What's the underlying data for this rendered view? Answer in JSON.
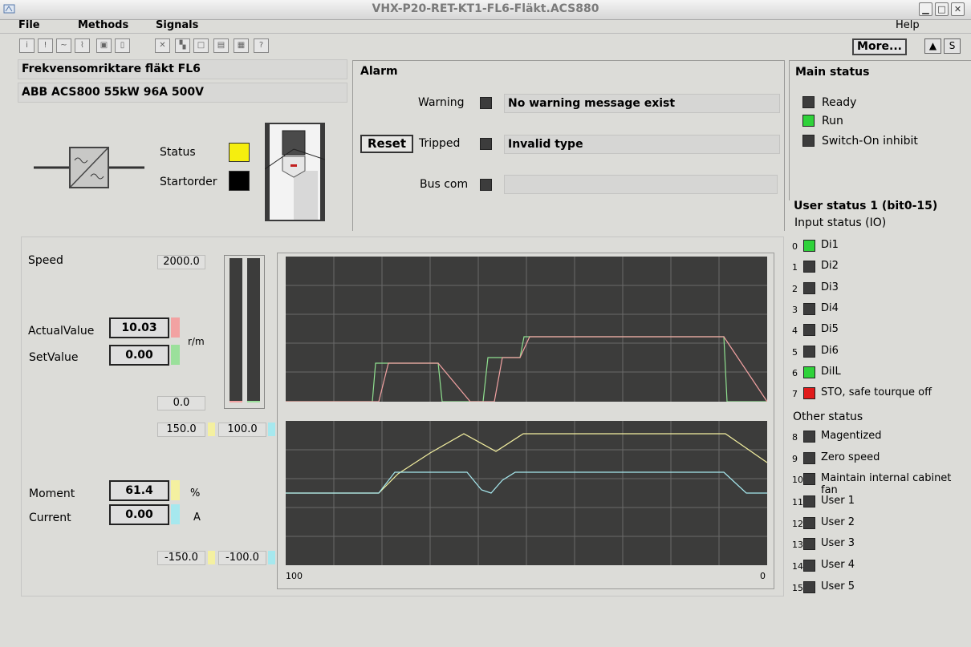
{
  "window": {
    "title": "VHX-P20-RET-KT1-FL6-Fläkt.ACS880"
  },
  "menu": {
    "file": "File",
    "methods": "Methods",
    "signals": "Signals",
    "help": "Help"
  },
  "toolbar": {
    "more_label": "More..."
  },
  "device": {
    "name": "Frekvensomriktare fläkt FL6",
    "model": "ABB ACS800 55kW 96A 500V"
  },
  "indicators": {
    "status_label": "Status",
    "status_color": "#f5ee0f",
    "startorder_label": "Startorder",
    "startorder_color": "#000000"
  },
  "alarm": {
    "title": "Alarm",
    "reset_label": "Reset",
    "rows": [
      {
        "label": "Warning",
        "message": "No warning message exist"
      },
      {
        "label": "Tripped",
        "message": "Invalid type"
      },
      {
        "label": "Bus com",
        "message": ""
      }
    ]
  },
  "signals": {
    "speed_label": "Speed",
    "speed_max": "2000.0",
    "speed_min": "0.0",
    "actual_label": "ActualValue",
    "actual_value": "10.03",
    "set_label": "SetValue",
    "set_value": "0.00",
    "speed_unit": "r/m",
    "moment_max": "150.0",
    "current_max": "100.0",
    "moment_label": "Moment",
    "moment_value": "61.4",
    "moment_unit": "%",
    "current_label": "Current",
    "current_value": "0.00",
    "current_unit": "A",
    "moment_min": "-150.0",
    "current_min": "-100.0",
    "time_start": "100",
    "time_end": "0",
    "colors": {
      "actual": "#f2a2a2",
      "set": "#9be09b",
      "moment": "#f4f0a0",
      "current": "#a6e8ee"
    }
  },
  "main_status": {
    "title": "Main status",
    "items": [
      {
        "label": "Ready",
        "state": "off"
      },
      {
        "label": "Run",
        "state": "green"
      },
      {
        "label": "Switch-On inhibit",
        "state": "off"
      }
    ]
  },
  "user_status": {
    "title": "User status 1 (bit0-15)",
    "input_title": "Input status (IO)",
    "other_title": "Other status",
    "items": [
      {
        "idx": "0",
        "label": "Di1",
        "state": "green"
      },
      {
        "idx": "1",
        "label": "Di2",
        "state": "off"
      },
      {
        "idx": "2",
        "label": "Di3",
        "state": "off"
      },
      {
        "idx": "3",
        "label": "Di4",
        "state": "off"
      },
      {
        "idx": "4",
        "label": "Di5",
        "state": "off"
      },
      {
        "idx": "5",
        "label": "Di6",
        "state": "off"
      },
      {
        "idx": "6",
        "label": "DiIL",
        "state": "green"
      },
      {
        "idx": "7",
        "label": "STO, safe tourque off",
        "state": "red"
      },
      {
        "idx": "8",
        "label": "Magentized",
        "state": "off"
      },
      {
        "idx": "9",
        "label": "Zero speed",
        "state": "off"
      },
      {
        "idx": "10",
        "label": "Maintain internal cabinet fan",
        "state": "off"
      },
      {
        "idx": "11",
        "label": "User 1",
        "state": "off"
      },
      {
        "idx": "12",
        "label": "User 2",
        "state": "off"
      },
      {
        "idx": "13",
        "label": "User 3",
        "state": "off"
      },
      {
        "idx": "14",
        "label": "User 4",
        "state": "off"
      },
      {
        "idx": "15",
        "label": "User 5",
        "state": "off"
      }
    ]
  }
}
